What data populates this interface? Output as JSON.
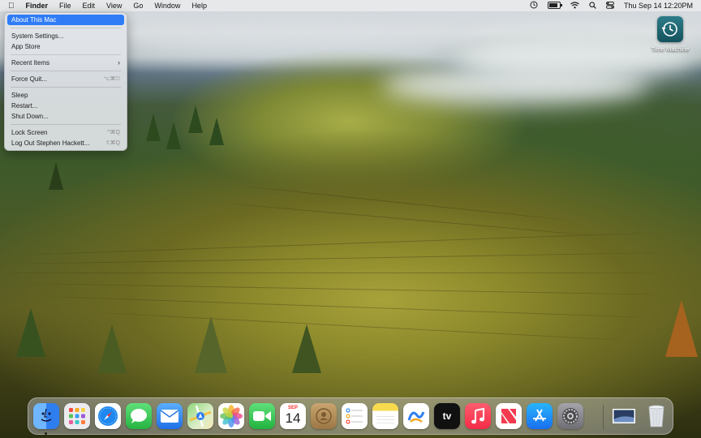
{
  "menubar": {
    "apple": "",
    "app_name": "Finder",
    "menus": [
      "File",
      "Edit",
      "View",
      "Go",
      "Window",
      "Help"
    ],
    "clock": "Thu Sep 14  12:20PM",
    "battery_level": 0.8
  },
  "apple_menu": {
    "items": [
      {
        "label": "About This Mac",
        "shortcut": ""
      },
      {
        "label": "System Settings...",
        "shortcut": ""
      },
      {
        "label": "App Store",
        "shortcut": ""
      },
      {
        "label": "Recent Items",
        "shortcut": ""
      },
      {
        "label": "Force Quit...",
        "shortcut": "⌥⌘⎋"
      },
      {
        "label": "Sleep",
        "shortcut": ""
      },
      {
        "label": "Restart...",
        "shortcut": ""
      },
      {
        "label": "Shut Down...",
        "shortcut": ""
      },
      {
        "label": "Lock Screen",
        "shortcut": "^⌘Q"
      },
      {
        "label": "Log Out Stephen Hackett...",
        "shortcut": "⇧⌘Q"
      }
    ]
  },
  "desktop": {
    "time_machine_label": "Time Machine"
  },
  "dock": {
    "apps": [
      {
        "name": "Finder",
        "icon": "finder-icon",
        "color": "#3d8ef7",
        "running": true
      },
      {
        "name": "Launchpad",
        "icon": "launchpad-icon",
        "color": "#e8e8ec",
        "running": false
      },
      {
        "name": "Safari",
        "icon": "safari-icon",
        "color": "#1e88f0",
        "running": false
      },
      {
        "name": "Messages",
        "icon": "messages-icon",
        "color": "#34c759",
        "running": false
      },
      {
        "name": "Mail",
        "icon": "mail-icon",
        "color": "#3b8ff0",
        "running": false
      },
      {
        "name": "Maps",
        "icon": "maps-icon",
        "color": "#6cc070",
        "running": false
      },
      {
        "name": "Photos",
        "icon": "photos-icon",
        "color": "#ffffff",
        "running": false
      },
      {
        "name": "FaceTime",
        "icon": "facetime-icon",
        "color": "#30c04c",
        "running": false
      },
      {
        "name": "Calendar",
        "icon": "calendar-icon",
        "color": "#ffffff",
        "running": false,
        "month": "SEP",
        "day": "14"
      },
      {
        "name": "Contacts",
        "icon": "contacts-icon",
        "color": "#b08a5a",
        "running": false
      },
      {
        "name": "Reminders",
        "icon": "reminders-icon",
        "color": "#ffffff",
        "running": false
      },
      {
        "name": "Notes",
        "icon": "notes-icon",
        "color": "#f5d64a",
        "running": false
      },
      {
        "name": "Freeform",
        "icon": "freeform-icon",
        "color": "#ffffff",
        "running": false
      },
      {
        "name": "TV",
        "icon": "tv-icon",
        "color": "#111111",
        "running": false,
        "text": "tv"
      },
      {
        "name": "Music",
        "icon": "music-icon",
        "color": "#fa3b4d",
        "running": false
      },
      {
        "name": "News",
        "icon": "news-icon",
        "color": "#ffffff",
        "running": false
      },
      {
        "name": "App Store",
        "icon": "app-store-icon",
        "color": "#1a8cf4",
        "running": false
      },
      {
        "name": "System Settings",
        "icon": "system-settings-icon",
        "color": "#8e8e93",
        "running": false
      },
      {
        "name": "Desktop Folder",
        "icon": "desktop-stack-icon",
        "color": "#2a3d63",
        "running": false
      },
      {
        "name": "Trash",
        "icon": "trash-icon",
        "color": "#d8dde2",
        "running": false
      }
    ]
  }
}
